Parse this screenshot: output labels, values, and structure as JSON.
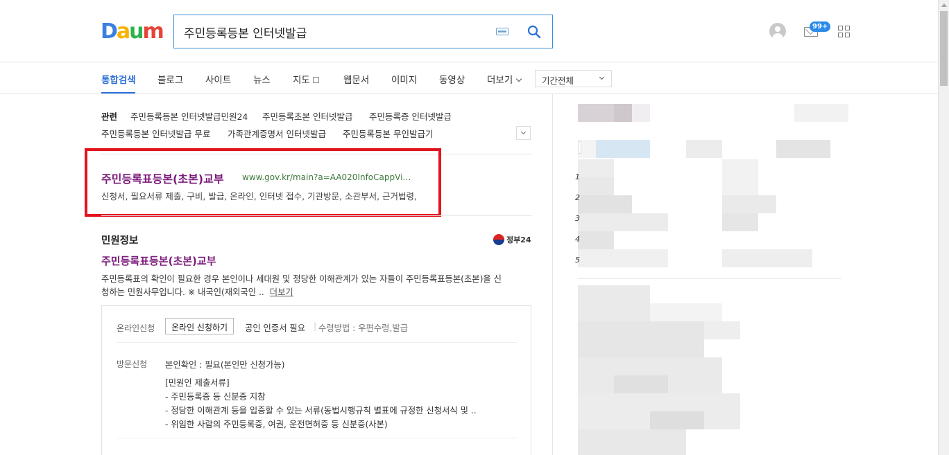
{
  "header": {
    "logo": [
      "D",
      "a",
      "u",
      "m"
    ],
    "logo_colors": [
      "#3b7fe0",
      "#f5b400",
      "#2fb24c",
      "#e8433a"
    ],
    "search_value": "주민등록등본 인터넷발급",
    "mail_badge": "99+"
  },
  "tabs": {
    "items": [
      "통합검색",
      "블로그",
      "사이트",
      "뉴스",
      "지도",
      "웹문서",
      "이미지",
      "동영상",
      "더보기"
    ],
    "period": "기간전체"
  },
  "related": {
    "label": "관련",
    "items": [
      "주민등록등본 인터넷발급민원24",
      "주민등록초본 인터넷발급",
      "주민등록증 인터넷발급",
      "주민등록등본 인터넷발급 무료",
      "가족관계증명서 인터넷발급",
      "주민등록등본 무인발급기"
    ]
  },
  "result1": {
    "title": "주민등록표등본(초본)교부",
    "url": "www.gov.kr/main?a=AA020InfoCappVi…",
    "desc": "신청서, 필요서류 제출, 구비, 발급, 온라인, 인터넷 접수, 기관방문, 소관부서, 근거법령,"
  },
  "minwon": {
    "section_title": "민원정보",
    "gov_logo": "정부24",
    "title": "주민등록표등본(초본)교부",
    "desc_line1": "주민등록표의 확인이 필요한 경우 본인이나 세대원 및 정당한 이해관계가 있는 자들이 주민등록표등본(초본)을 신",
    "desc_line2": "청하는 민원사무입니다. ※ 내국인(재외국인 ..",
    "more": "더보기",
    "online_label": "온라인신청",
    "online_btn": "온라인 신청하기",
    "cert": "공인 인증서 필요",
    "receive": "수령방법 : 우편수령,발급",
    "visit_label": "방문신청",
    "visit_lines": [
      "본인확인 : 필요(본인만 신청가능)",
      "[민원인 제출서류]",
      "- 주민등록증 등 신분증 지참",
      "- 정당한 이해관계 등을 입증할 수 있는 서류(동법시행규칙 별표에 규정한 신청서식 및 ..",
      "- 위임한 사람의 주민등록증, 여권, 운전면허증 등 신분증(사본)"
    ]
  },
  "sidebar_ranks": [
    "1",
    "2",
    "3",
    "4",
    "5"
  ]
}
